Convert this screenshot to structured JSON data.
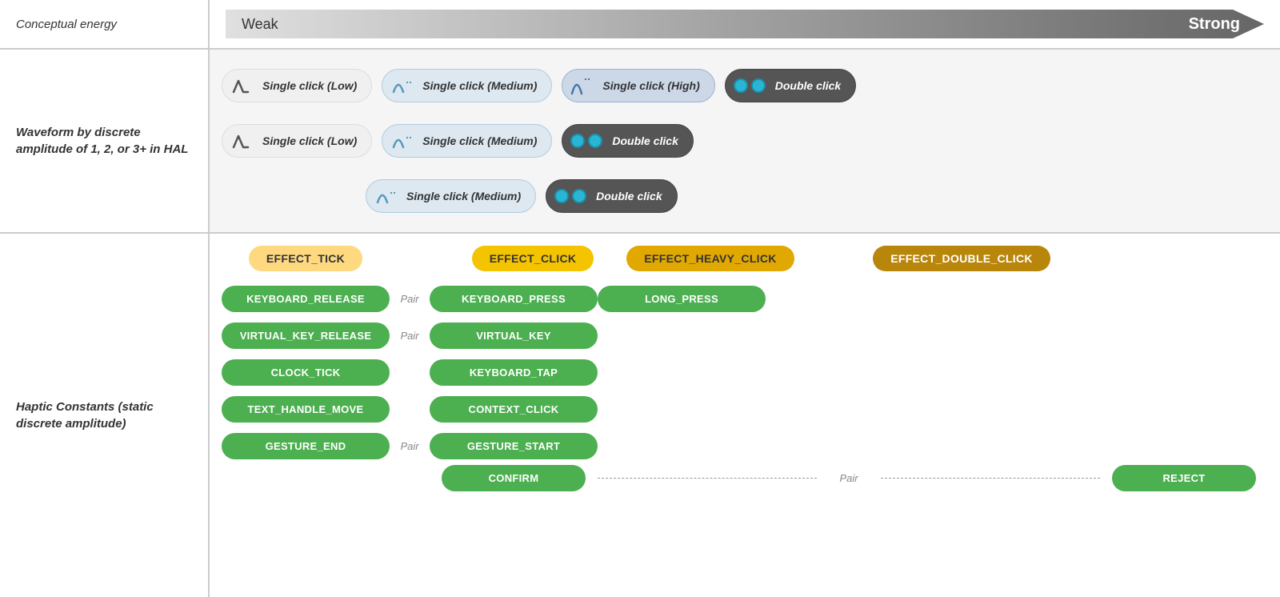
{
  "labels": {
    "conceptual_energy": "Conceptual energy",
    "weak": "Weak",
    "strong": "Strong",
    "waveform_label": "Waveform by discrete amplitude of 1, 2, or 3+ in HAL",
    "haptic_label": "Haptic Constants (static discrete amplitude)"
  },
  "waveform_rows": [
    {
      "pills": [
        {
          "type": "low",
          "text": "Single click (Low)"
        },
        {
          "type": "medium",
          "text": "Single click (Medium)"
        },
        {
          "type": "high",
          "text": "Single click (High)"
        },
        {
          "type": "dark",
          "text": "Double click"
        }
      ]
    },
    {
      "pills": [
        {
          "type": "low",
          "text": "Single click (Low)"
        },
        {
          "type": "medium",
          "text": "Single click (Medium)"
        },
        {
          "type": "dark",
          "text": "Double click"
        }
      ]
    },
    {
      "pills": [
        {
          "type": "medium",
          "text": "Single click (Medium)"
        },
        {
          "type": "dark",
          "text": "Double click"
        }
      ]
    }
  ],
  "effects": [
    {
      "label": "EFFECT_TICK",
      "style": "light"
    },
    {
      "label": "EFFECT_CLICK",
      "style": "medium"
    },
    {
      "label": "EFFECT_HEAVY_CLICK",
      "style": "heavy"
    },
    {
      "label": "EFFECT_DOUBLE_CLICK",
      "style": "double"
    }
  ],
  "haptic_rows": [
    {
      "col1": "KEYBOARD_RELEASE",
      "pair1": "Pair",
      "col2": "KEYBOARD_PRESS",
      "col3": "LONG_PRESS",
      "col4": ""
    },
    {
      "col1": "VIRTUAL_KEY_RELEASE",
      "pair1": "Pair",
      "col2": "VIRTUAL_KEY",
      "col3": "",
      "col4": ""
    },
    {
      "col1": "CLOCK_TICK",
      "pair1": "",
      "col2": "KEYBOARD_TAP",
      "col3": "",
      "col4": ""
    },
    {
      "col1": "TEXT_HANDLE_MOVE",
      "pair1": "",
      "col2": "CONTEXT_CLICK",
      "col3": "",
      "col4": ""
    },
    {
      "col1": "GESTURE_END",
      "pair1": "Pair",
      "col2": "GESTURE_START",
      "col3": "",
      "col4": ""
    }
  ],
  "confirm": {
    "label": "CONFIRM",
    "pair": "Pair",
    "reject": "REJECT"
  }
}
